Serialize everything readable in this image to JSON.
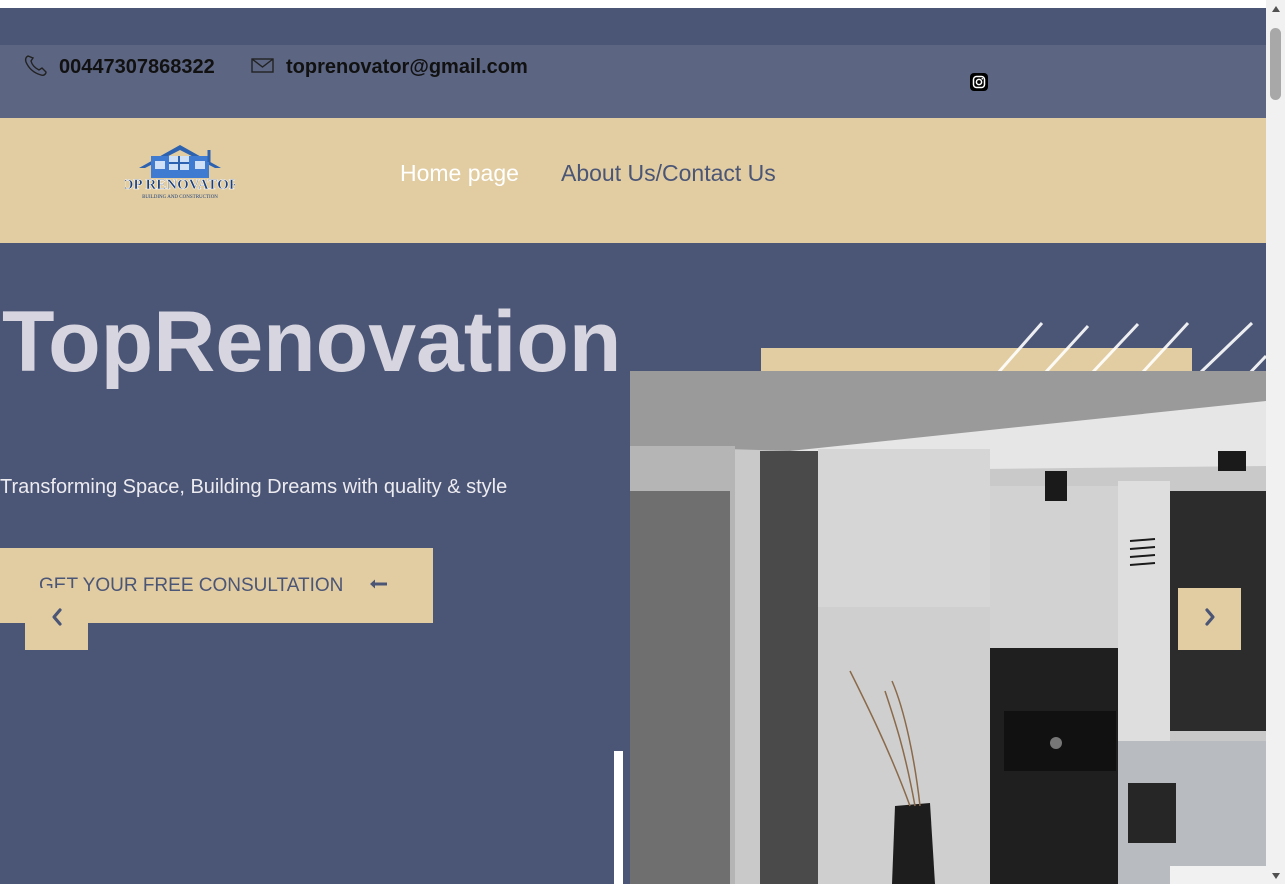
{
  "contact": {
    "phone": "00447307868322",
    "email": "toprenovator@gmail.com"
  },
  "logo": {
    "line1": "TOP RENOVATORS",
    "line2": "BUILDING AND CONSTRUCTION"
  },
  "nav": {
    "home": "Home page",
    "about": "About Us/Contact Us"
  },
  "hero": {
    "title": "TopRenovation",
    "subtitle": "Transforming Space, Building Dreams with quality & style",
    "cta": "GET YOUR FREE CONSULTATION"
  },
  "colors": {
    "navy": "#4b5575",
    "sand": "#e2cda2",
    "slate": "#5c6683"
  },
  "icons": [
    "phone-icon",
    "mail-icon",
    "instagram-icon",
    "arrow-left-icon",
    "chevron-left-icon",
    "chevron-right-icon"
  ]
}
